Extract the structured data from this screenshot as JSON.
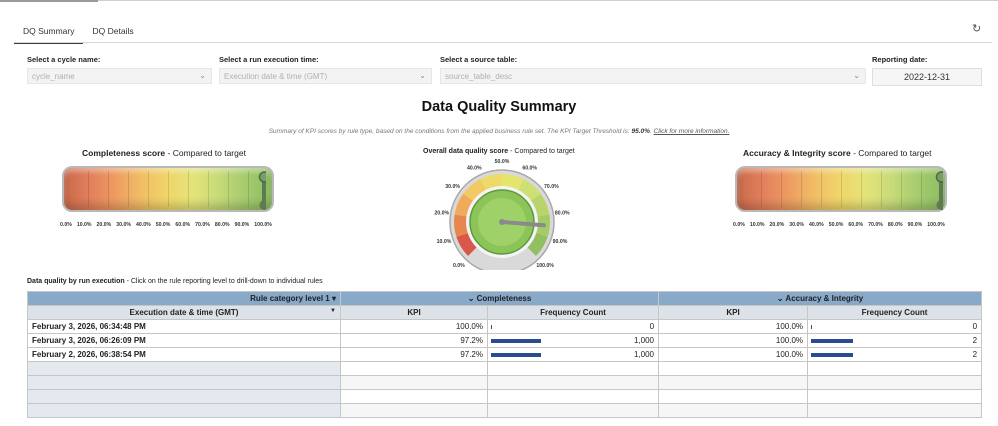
{
  "tabs": [
    {
      "label": "DQ Summary"
    },
    {
      "label": "DQ Details"
    }
  ],
  "filters": {
    "cycle": {
      "label": "Select a cycle name:",
      "placeholder": "cycle_name"
    },
    "run": {
      "label": "Select a run execution time:",
      "placeholder": "Execution date & time (GMT)"
    },
    "source": {
      "label": "Select a source table:",
      "placeholder": "source_table_desc"
    },
    "reporting": {
      "label": "Reporting date:",
      "value": "2022-12-31"
    }
  },
  "page": {
    "title": "Data Quality Summary",
    "subtitle_pre": "Summary of KPI scores by rule type, based on the conditions from the applied business rule set.  The KPI Target Threshold is: ",
    "threshold": "95.0%",
    "subtitle_post": ".  ",
    "link": "Click  for more information."
  },
  "gauges": {
    "completeness": {
      "title": "Completeness score",
      "suffix": " - Compared to target",
      "value_pct": 97.8,
      "target_pct": 95.0
    },
    "overall": {
      "title": "Overall data quality score",
      "suffix": " - Compared to target",
      "value_pct": 85.0,
      "ticks": [
        "0.0%",
        "10.0%",
        "20.0%",
        "30.0%",
        "40.0%",
        "50.0%",
        "60.0%",
        "70.0%",
        "80.0%",
        "90.0%",
        "100.0%"
      ]
    },
    "accuracy": {
      "title": "Accuracy & Integrity score",
      "suffix": " - Compared to target",
      "value_pct": 100.0,
      "target_pct": 95.0
    },
    "bar_ticks": [
      "0.0%",
      "10.0%",
      "20.0%",
      "30.0%",
      "40.0%",
      "50.0%",
      "60.0%",
      "70.0%",
      "80.0%",
      "90.0%",
      "100.0%"
    ]
  },
  "table": {
    "label": "Data quality by run execution",
    "label_suffix": " - Click on the rule reporting level to drill-down to individual rules",
    "cat_header": "Rule category level 1 ▾",
    "groups": [
      "⌄ Completeness",
      "⌄ Accuracy & Integrity"
    ],
    "row_header": "Execution date & time (GMT)",
    "cols": [
      "KPI",
      "Frequency Count",
      "KPI",
      "Frequency Count"
    ],
    "rows": [
      {
        "time": "February 3, 2026, 06:34:48 PM",
        "c_kpi": "100.0%",
        "c_freq": "0",
        "c_freq_frac": 0,
        "a_kpi": "100.0%",
        "a_freq": "0",
        "a_freq_frac": 0
      },
      {
        "time": "February 3, 2026, 06:26:09 PM",
        "c_kpi": "97.2%",
        "c_freq": "1,000",
        "c_freq_frac": 0.36,
        "a_kpi": "100.0%",
        "a_freq": "2",
        "a_freq_frac": 0.3
      },
      {
        "time": "February 2, 2026, 06:38:54 PM",
        "c_kpi": "97.2%",
        "c_freq": "1,000",
        "c_freq_frac": 0.36,
        "a_kpi": "100.0%",
        "a_freq": "2",
        "a_freq_frac": 0.3
      }
    ]
  }
}
